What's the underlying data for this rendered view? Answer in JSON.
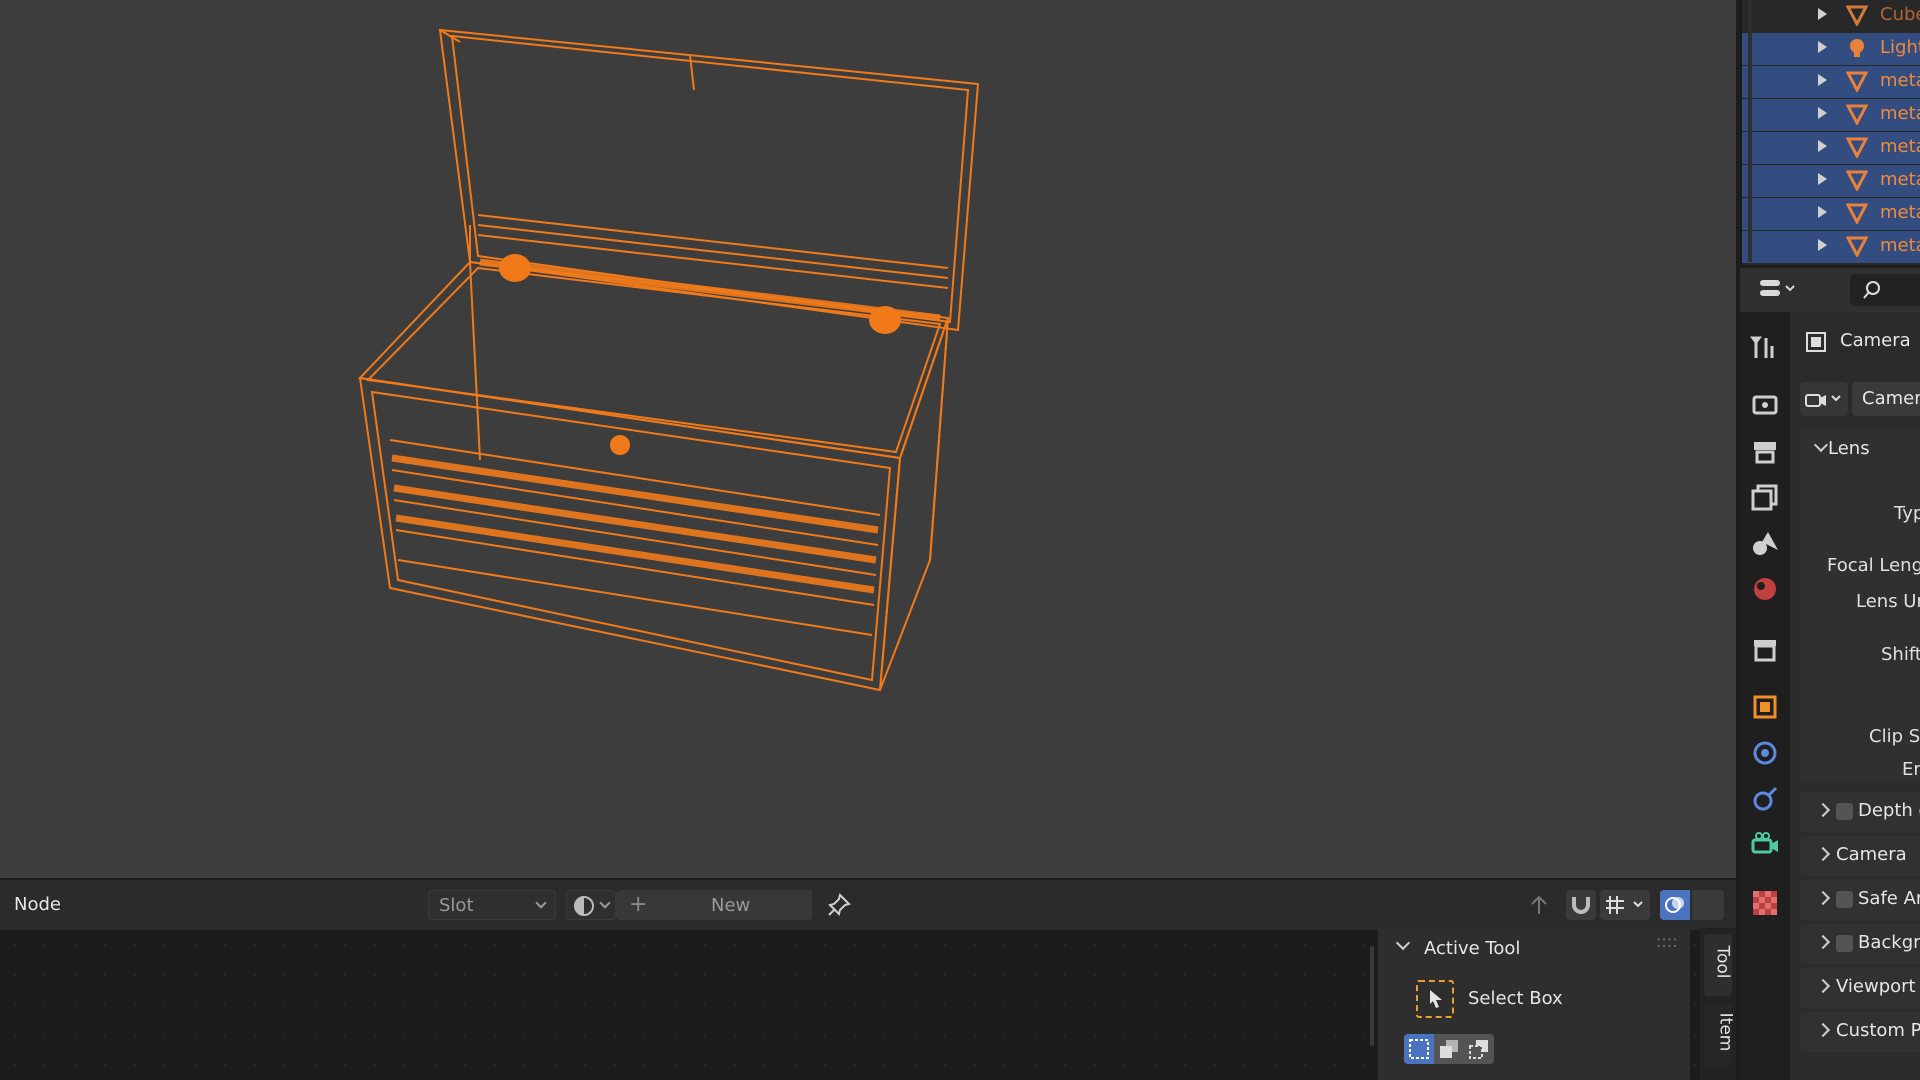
{
  "outliner": {
    "items": [
      {
        "label": "Cube",
        "icon": "mesh-icon"
      },
      {
        "label": "Light",
        "icon": "light-icon"
      },
      {
        "label": "meta",
        "icon": "mesh-icon"
      },
      {
        "label": "meta",
        "icon": "mesh-icon"
      },
      {
        "label": "meta",
        "icon": "mesh-icon"
      },
      {
        "label": "meta",
        "icon": "mesh-icon"
      },
      {
        "label": "meta",
        "icon": "mesh-icon"
      },
      {
        "label": "meta",
        "icon": "mesh-icon"
      }
    ]
  },
  "properties": {
    "object_name": "Camera",
    "data_name": "Camera",
    "lens_panel": "Lens",
    "lens_fields": [
      "Type",
      "Focal Length",
      "Lens Unit",
      "Shift",
      "Clip Start",
      "End"
    ],
    "lens_fields_visible": [
      "Typ",
      "Focal Lengt",
      "Lens Ur",
      "Shift",
      "Clip Sta",
      "Er"
    ],
    "panels": [
      "Depth o",
      "Camera",
      "Safe Are",
      "Backgro",
      "Viewport D",
      "Custom Pr"
    ]
  },
  "node_editor": {
    "editor_label": "Node",
    "slot_label": "Slot",
    "new_label": "New",
    "sidebar": {
      "panel_title": "Active Tool",
      "tool_name": "Select Box",
      "tabs": [
        "Tool",
        "Item"
      ]
    }
  },
  "colors": {
    "selection_orange": "#f07a1a",
    "viewport_bg": "#3d3d3d",
    "outliner_selected": "#334d80"
  }
}
